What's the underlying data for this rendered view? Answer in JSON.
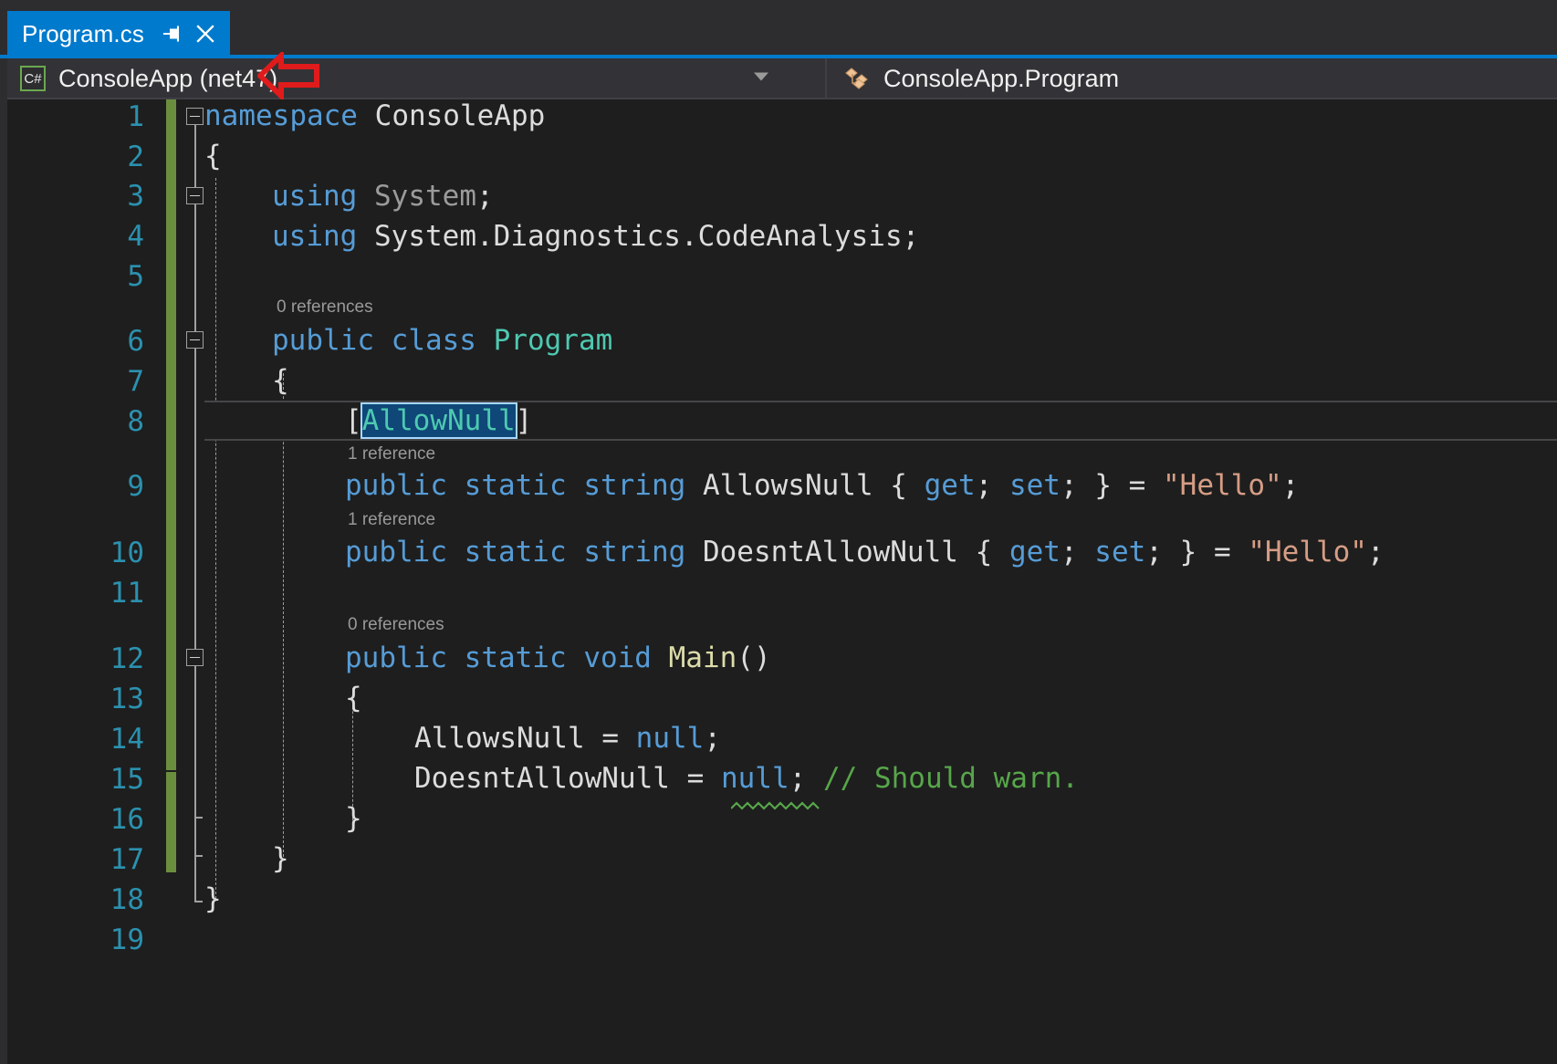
{
  "window": {
    "accent_color": "#007acc",
    "editor_bg": "#1e1e1e",
    "chrome_bg": "#2d2d30"
  },
  "tab": {
    "title": "Program.cs",
    "pin_icon": "pin-icon",
    "close_icon": "close-icon"
  },
  "navbar": {
    "project": {
      "icon": "csharp-file-icon",
      "icon_label": "C#",
      "label": "ConsoleApp (net47)",
      "caret_icon": "chevron-down-icon"
    },
    "member": {
      "icon": "class-icon",
      "label": "ConsoleApp.Program"
    }
  },
  "annotation": {
    "type": "arrow-left",
    "color": "#e01b1b"
  },
  "editor": {
    "change_bar_color": "#6b8e3e",
    "selection": {
      "text": "AllowNull",
      "fill": "#0e4778",
      "border": "#a6d8ff"
    },
    "codelens": [
      {
        "line": 6,
        "text": "0 references"
      },
      {
        "line": 9,
        "text": "1 reference"
      },
      {
        "line": 10,
        "text": "1 reference"
      },
      {
        "line": 12,
        "text": "0 references"
      }
    ],
    "line_numbers": [
      1,
      2,
      3,
      4,
      5,
      6,
      7,
      8,
      9,
      10,
      11,
      12,
      13,
      14,
      15,
      16,
      17,
      18,
      19
    ],
    "lines": [
      {
        "n": 1,
        "text": "namespace ConsoleApp"
      },
      {
        "n": 2,
        "text": " {"
      },
      {
        "n": 3,
        "text": "     using System;"
      },
      {
        "n": 4,
        "text": "     using System.Diagnostics.CodeAnalysis;"
      },
      {
        "n": 5,
        "text": ""
      },
      {
        "n": 6,
        "text": "     public class Program"
      },
      {
        "n": 7,
        "text": "     {"
      },
      {
        "n": 8,
        "text": "         [AllowNull]"
      },
      {
        "n": 9,
        "text": "         public static string AllowsNull { get; set; } = \"Hello\";"
      },
      {
        "n": 10,
        "text": "         public static string DoesntAllowNull { get; set; } = \"Hello\";"
      },
      {
        "n": 11,
        "text": ""
      },
      {
        "n": 12,
        "text": "         public static void Main()"
      },
      {
        "n": 13,
        "text": "         {"
      },
      {
        "n": 14,
        "text": "             AllowsNull = null;"
      },
      {
        "n": 15,
        "text": "             DoesntAllowNull = null; // Should warn."
      },
      {
        "n": 16,
        "text": "         }"
      },
      {
        "n": 17,
        "text": "     }"
      },
      {
        "n": 18,
        "text": " }"
      },
      {
        "n": 19,
        "text": ""
      }
    ],
    "current_line": 8,
    "warning_squiggle": {
      "line": 15,
      "token": "null",
      "color": "#57a64a"
    },
    "syntax_colors": {
      "keyword": "#569cd6",
      "type": "#4ec9b0",
      "string": "#d69d85",
      "comment": "#57a64a",
      "identifier": "#dcdcdc",
      "line_number": "#2b91af",
      "codelens": "#999999"
    }
  }
}
